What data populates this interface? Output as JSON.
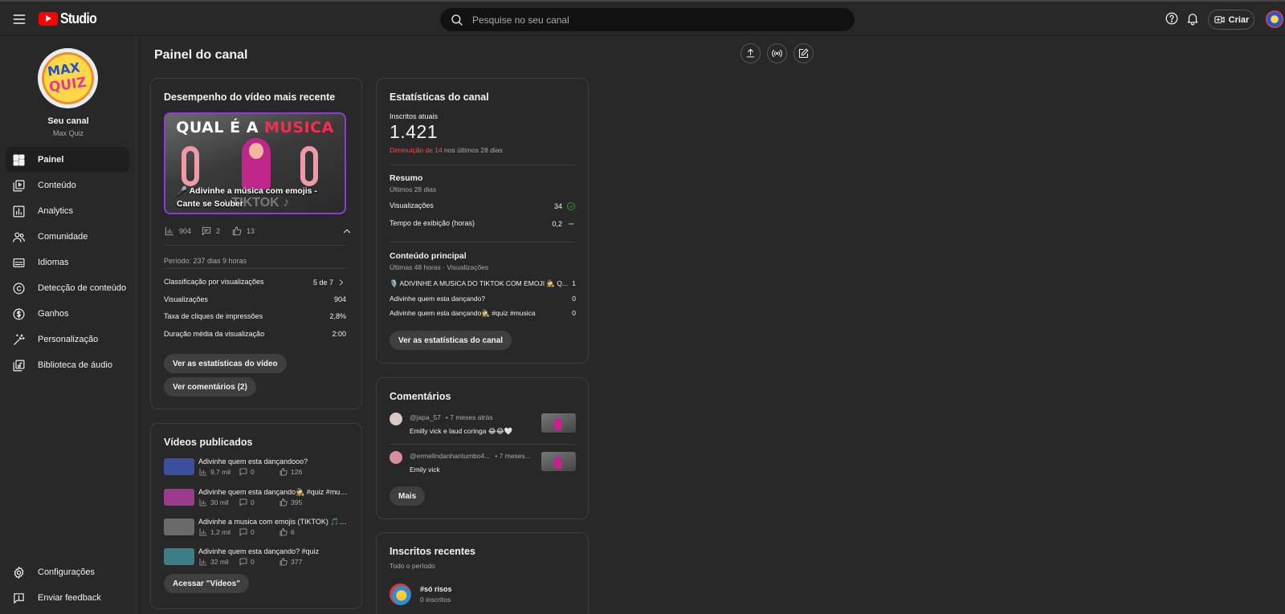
{
  "header": {
    "studio_label": "Studio",
    "search_placeholder": "Pesquise no seu canal",
    "create_label": "Criar"
  },
  "sidebar": {
    "channel_title": "Seu canal",
    "channel_name": "Max Quiz",
    "avatar_text_1": "MAX",
    "avatar_text_2": "QUIZ",
    "items": [
      {
        "label": "Painel",
        "icon": "dashboard-icon"
      },
      {
        "label": "Conteúdo",
        "icon": "content-icon"
      },
      {
        "label": "Analytics",
        "icon": "analytics-icon"
      },
      {
        "label": "Comunidade",
        "icon": "community-icon"
      },
      {
        "label": "Idiomas",
        "icon": "subtitles-icon"
      },
      {
        "label": "Detecção de conteúdo",
        "icon": "copyright-icon"
      },
      {
        "label": "Ganhos",
        "icon": "dollar-icon"
      },
      {
        "label": "Personalização",
        "icon": "magic-wand-icon"
      },
      {
        "label": "Biblioteca de áudio",
        "icon": "audio-library-icon"
      }
    ],
    "bottom": [
      {
        "label": "Configurações",
        "icon": "gear-icon"
      },
      {
        "label": "Enviar feedback",
        "icon": "feedback-icon"
      }
    ]
  },
  "page": {
    "title": "Painel do canal"
  },
  "latest_video": {
    "card_title": "Desempenho do vídeo mais recente",
    "thumb_headline_1": "QUAL É A",
    "thumb_headline_2": "MUSICA",
    "thumb_caption": "🎤 Adivinhe a música com emojis - Cante se Souber",
    "thumb_watermark": "♪ TIKTOK ♪",
    "views": "904",
    "comments": "2",
    "likes": "13",
    "period": "Período: 237 dias 9 horas",
    "rows": [
      {
        "label": "Classificação por visualizações",
        "value": "5 de 7"
      },
      {
        "label": "Visualizações",
        "value": "904"
      },
      {
        "label": "Taxa de cliques de impressões",
        "value": "2,8%"
      },
      {
        "label": "Duração média da visualização",
        "value": "2:00"
      }
    ],
    "stats_button": "Ver as estatísticas do vídeo",
    "comments_button": "Ver comentários (2)"
  },
  "published": {
    "card_title": "Vídeos publicados",
    "videos": [
      {
        "title": "Adivinhe quem esta dançandooo?",
        "views": "9,7 mil",
        "comments": "0",
        "likes": "126",
        "color": "#3b4f9e"
      },
      {
        "title": "Adivinhe quem esta dançando🕵️ #quiz #musica",
        "views": "30 mil",
        "comments": "0",
        "likes": "395",
        "color": "#9c3a8e"
      },
      {
        "title": "Adivinhe a musica com emojis (TIKTOK) 🎵 Quiz",
        "views": "1,2 mil",
        "comments": "0",
        "likes": "6",
        "color": "#6a6a6a"
      },
      {
        "title": "Adivinhe quem esta dançando? #quiz",
        "views": "32 mil",
        "comments": "0",
        "likes": "377",
        "color": "#3a7f86"
      }
    ],
    "button": "Acessar \"Vídeos\""
  },
  "channel_stats": {
    "card_title": "Estatísticas do canal",
    "subs_label": "Inscritos atuais",
    "subs_count": "1.421",
    "subs_change_red": "Diminuição de 14",
    "subs_change_rest": " nos últimos 28 dias",
    "summary_title": "Resumo",
    "summary_period": "Últimos 28 dias",
    "summary_rows": [
      {
        "label": "Visualizações",
        "value": "34"
      },
      {
        "label": "Tempo de exibição (horas)",
        "value": "0,2"
      }
    ],
    "top_title": "Conteúdo principal",
    "top_period": "Últimas 48 horas · Visualizações",
    "top_rows": [
      {
        "label": "🎙️ ADIVINHE A MUSICA DO TIKTOK COM EMOJI 🕵️ Q...",
        "value": "1"
      },
      {
        "label": "Adivinhe quem esta dançando?",
        "value": "0"
      },
      {
        "label": "Adivinhe quem esta dançando🕵️ #quiz #musica",
        "value": "0"
      }
    ],
    "button": "Ver as estatísticas do canal"
  },
  "comments": {
    "card_title": "Comentários",
    "items": [
      {
        "user": "@japa_57",
        "time": "• 7 meses atrás",
        "text": "Emilly vick e laud coringa 😂😂🤍"
      },
      {
        "user": "@ermelindanhantumbo4...",
        "time": "• 7 meses...",
        "text": "Emily vick"
      }
    ],
    "more_button": "Mais"
  },
  "recent_subs": {
    "card_title": "Inscritos recentes",
    "period": "Todo o período",
    "items": [
      {
        "name": "#só risos",
        "subs": "0 inscritos"
      }
    ]
  },
  "colors": {
    "background": "#282828",
    "accent_red": "#ff0000",
    "decrease_red": "#ff4e45",
    "ok_green": "#2ba640"
  }
}
